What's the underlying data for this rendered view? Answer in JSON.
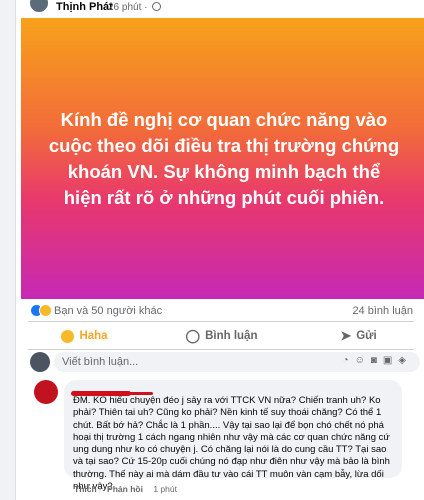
{
  "post": {
    "author": "Thịnh Phát",
    "time": "26 phút",
    "banner_text": "Kính đề nghị cơ quan chức năng vào cuộc theo dõi điều tra thị trường chứng khoán VN. Sự không minh bạch thể hiện rất rõ ở những phút cuối phiên."
  },
  "stats": {
    "reactions_text": "Bạn và 50 người khác",
    "comments_count": "24 bình luận",
    "reaction_icons": [
      "like-icon",
      "haha-icon"
    ]
  },
  "actions": {
    "haha_label": "Haha",
    "comment_label": "Bình luận",
    "share_label": "Gửi"
  },
  "composer": {
    "placeholder": "Viết bình luận..."
  },
  "comment": {
    "text": "ĐM. KO hiểu chuyện đéo j sảy ra với TTCK VN nữa? Chiến tranh uh? Ko phải? Thiên tai uh? Cũng ko phải? Nền kinh tế suy thoái chăng? Có thể 1 chút. Bất bớ hả? Chắc là 1 phần.... Vậy tại sao lại để bọn chó chết nó phá hoại thị trường 1 cách ngang nhiên như vậy mà các cơ quan chức năng cứ ung dung như ko có chuyện j. Có chăng lại nói là do cung cầu TT? Tại sao và tại sao? Cứ 15-20p cuối chúng nó đạp như điên như vậy mà bảo là bình thường. Thế này ai mà dám đầu tư vào cái TT muôn vàn cạm bẫy, lừa dối như vậy?",
    "like_label": "Thích",
    "reply_label": "Phản hồi",
    "time": "1 phút"
  },
  "colors": {
    "accent_haha": "#f5a623",
    "banner_top": "#f7a21b",
    "banner_bottom": "#c629b4"
  }
}
